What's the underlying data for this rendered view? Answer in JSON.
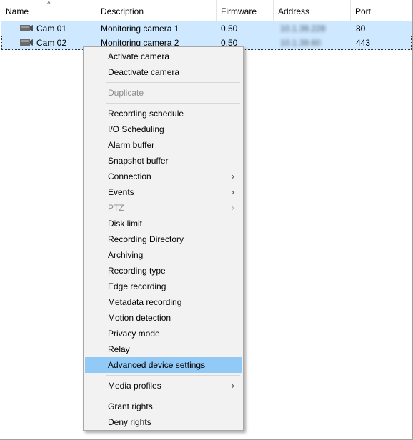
{
  "columns": [
    {
      "label": "Name"
    },
    {
      "label": "Description"
    },
    {
      "label": "Firmware"
    },
    {
      "label": "Address"
    },
    {
      "label": "Port"
    }
  ],
  "rows": [
    {
      "name": "Cam 01",
      "description": "Monitoring camera 1",
      "firmware": "0.50",
      "address": "10.1.39.228",
      "port": "80"
    },
    {
      "name": "Cam 02",
      "description": "Monitoring camera 2",
      "firmware": "0.50",
      "address": "10.1.39.60",
      "port": "443"
    }
  ],
  "menu": {
    "items": [
      {
        "label": "Activate camera"
      },
      {
        "label": "Deactivate camera"
      },
      {
        "label": "Duplicate",
        "disabled": true
      },
      {
        "label": "Recording schedule"
      },
      {
        "label": "I/O Scheduling"
      },
      {
        "label": "Alarm buffer"
      },
      {
        "label": "Snapshot buffer"
      },
      {
        "label": "Connection",
        "submenu": true
      },
      {
        "label": "Events",
        "submenu": true
      },
      {
        "label": "PTZ",
        "submenu": true,
        "disabled": true
      },
      {
        "label": "Disk limit"
      },
      {
        "label": "Recording Directory"
      },
      {
        "label": "Archiving"
      },
      {
        "label": "Recording type"
      },
      {
        "label": "Edge recording"
      },
      {
        "label": "Metadata recording"
      },
      {
        "label": "Motion detection"
      },
      {
        "label": "Privacy mode"
      },
      {
        "label": "Relay"
      },
      {
        "label": "Advanced device settings",
        "highlighted": true
      },
      {
        "label": "Media profiles",
        "submenu": true
      },
      {
        "label": "Grant rights"
      },
      {
        "label": "Deny rights"
      }
    ],
    "submenu_glyph": "›"
  },
  "colors": {
    "row_selected": "#cde8ff",
    "menu_highlight": "#91c9f7",
    "menu_bg": "#f2f2f2"
  }
}
